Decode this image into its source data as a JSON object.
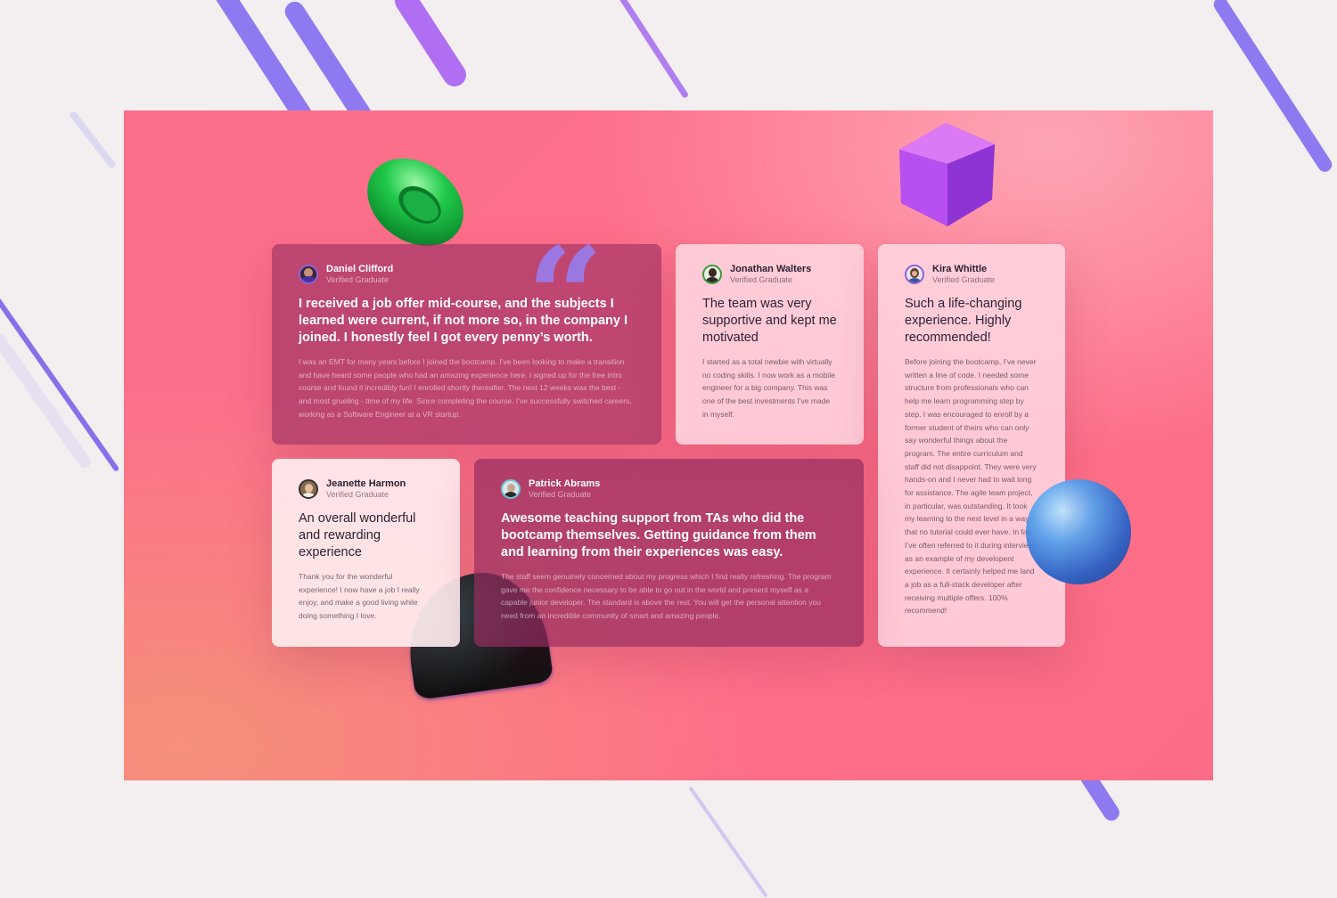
{
  "icons": {
    "quote": "quote-mark-icon",
    "torus": "green-torus-shape",
    "cube": "purple-cube-shape",
    "sphere": "blue-sphere-shape",
    "cone": "dark-cone-shape"
  },
  "colors": {
    "accent": "#8a63d2",
    "panel": "#fa6f8c",
    "dark_card": "#962d5f",
    "light_card": "#ffd6e0"
  },
  "quote_glyph": "“",
  "testimonials": [
    {
      "name": "Daniel Clifford",
      "role": "Verified Graduate",
      "quote": "I received a job offer mid-course, and the subjects I learned were current, if not more so, in the company I joined. I honestly feel I got every penny’s worth.",
      "body": "I was an EMT for many years before I joined the bootcamp. I’ve been looking to make a transition and have heard some people who had an amazing experience here. I signed up for the free intro course and found it incredibly fun! I enrolled shortly thereafter. The next 12 weeks was the best - and most grueling - time of my life. Since completing the course, I’ve successfully switched careers, working as a Software Engineer at a VR startup."
    },
    {
      "name": "Jonathan Walters",
      "role": "Verified Graduate",
      "quote": "The team was very supportive and kept me motivated",
      "body": "I started as a total newbie with virtually no coding skills. I now work as a mobile engineer for a big company. This was one of the best investments I’ve made in myself."
    },
    {
      "name": "Kira Whittle",
      "role": "Verified Graduate",
      "quote": "Such a life-changing experience. Highly recommended!",
      "body": "Before joining the bootcamp, I’ve never written a line of code. I needed some structure from professionals who can help me learn programming step by step. I was encouraged to enroll by a former student of theirs who can only say wonderful things about the program. The entire curriculum and staff did not disappoint. They were very hands-on and I never had to wait long for assistance. The agile team project, in particular, was outstanding. It took my learning to the next level in a way that no tutorial could ever have. In fact, I’ve often referred to it during interviews as an example of my developent experience. It certainly helped me land a job as a full-stack developer after receiving multiple offers. 100% recommend!"
    },
    {
      "name": "Jeanette Harmon",
      "role": "Verified Graduate",
      "quote": "An overall wonderful and rewarding experience",
      "body": "Thank you for the wonderful experience! I now have a job I really enjoy, and make a good living while doing something I love."
    },
    {
      "name": "Patrick Abrams",
      "role": "Verified Graduate",
      "quote": "Awesome teaching support from TAs who did the bootcamp themselves. Getting guidance from them and learning from their experiences was easy.",
      "body": "The staff seem genuinely concerned about my progress which I find really refreshing. The program gave me the confidence necessary to be able to go out in the world and present myself as a capable junior developer. The standard is above the rest. You will get the personal attention you need from an incredible community of smart and amazing people."
    }
  ]
}
